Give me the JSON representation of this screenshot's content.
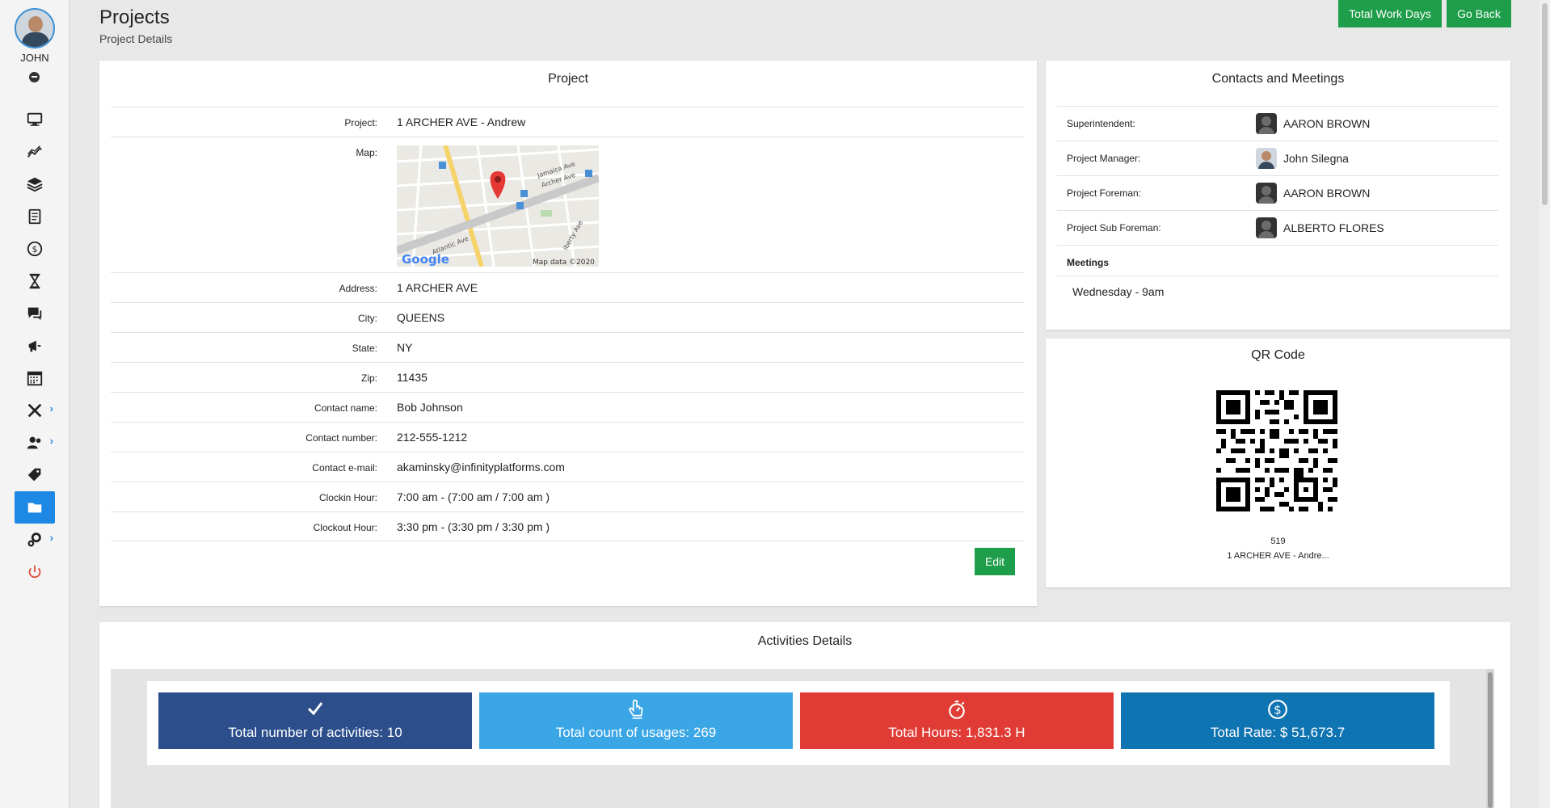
{
  "user": {
    "name": "JOHN"
  },
  "header": {
    "title": "Projects",
    "subtitle": "Project Details"
  },
  "actions": {
    "total_work_days": "Total Work Days",
    "go_back": "Go Back"
  },
  "sidebar": {
    "items": [
      {
        "icon": "monitor-icon",
        "active": false,
        "has_submenu": false
      },
      {
        "icon": "chart-line-icon",
        "active": false,
        "has_submenu": false
      },
      {
        "icon": "layers-icon",
        "active": false,
        "has_submenu": false
      },
      {
        "icon": "document-icon",
        "active": false,
        "has_submenu": false
      },
      {
        "icon": "dollar-icon",
        "active": false,
        "has_submenu": false
      },
      {
        "icon": "hourglass-icon",
        "active": false,
        "has_submenu": false
      },
      {
        "icon": "chat-icon",
        "active": false,
        "has_submenu": false
      },
      {
        "icon": "megaphone-icon",
        "active": false,
        "has_submenu": false
      },
      {
        "icon": "calendar-icon",
        "active": false,
        "has_submenu": false
      },
      {
        "icon": "tools-icon",
        "active": false,
        "has_submenu": true
      },
      {
        "icon": "users-icon",
        "active": false,
        "has_submenu": true
      },
      {
        "icon": "tags-icon",
        "active": false,
        "has_submenu": false
      },
      {
        "icon": "folder-icon",
        "active": true,
        "has_submenu": false
      },
      {
        "icon": "gears-icon",
        "active": false,
        "has_submenu": true
      },
      {
        "icon": "power-icon",
        "active": false,
        "has_submenu": false
      }
    ],
    "chevron": "›"
  },
  "project": {
    "title": "Project",
    "labels": {
      "project": "Project:",
      "map": "Map:",
      "address": "Address:",
      "city": "City:",
      "state": "State:",
      "zip": "Zip:",
      "contact_name": "Contact name:",
      "contact_number": "Contact number:",
      "contact_email": "Contact e-mail:",
      "clockin": "Clockin Hour:",
      "clockout": "Clockout Hour:"
    },
    "values": {
      "project": "1 ARCHER AVE - Andrew",
      "address": "1 ARCHER AVE",
      "city": "QUEENS",
      "state": "NY",
      "zip": "11435",
      "contact_name": "Bob Johnson",
      "contact_number": "212-555-1212",
      "contact_email": "akaminsky@infinityplatforms.com",
      "clockin": "7:00 am - (7:00 am / 7:00 am )",
      "clockout": "3:30 pm - (3:30 pm / 3:30 pm )"
    },
    "map": {
      "street_1": "Jamaica Ave",
      "street_2": "Archer Ave",
      "street_3": "Atlantic Ave",
      "street_4": "iberty Ave",
      "attribution": "Map data ©2020",
      "logo": "Google"
    },
    "edit_label": "Edit"
  },
  "contacts": {
    "title": "Contacts and Meetings",
    "rows": [
      {
        "role": "Superintendent:",
        "name": "AARON BROWN",
        "photo": false
      },
      {
        "role": "Project Manager:",
        "name": "John Silegna",
        "photo": true
      },
      {
        "role": "Project Foreman:",
        "name": "AARON BROWN",
        "photo": false
      },
      {
        "role": "Project Sub Foreman:",
        "name": "ALBERTO FLORES",
        "photo": false
      }
    ],
    "meetings_label": "Meetings",
    "meetings_value": "Wednesday - 9am"
  },
  "qr": {
    "title": "QR Code",
    "number": "519",
    "name": "1 ARCHER AVE - Andre..."
  },
  "activities": {
    "title": "Activities Details",
    "stats": [
      {
        "icon": "check-icon",
        "text": "Total number of activities: 10",
        "color": "#2c4f8c"
      },
      {
        "icon": "hand-pointer-icon",
        "text": "Total count of usages: 269",
        "color": "#3aa6e6"
      },
      {
        "icon": "stopwatch-icon",
        "text": "Total Hours: 1,831.3 H",
        "color": "#e03c35"
      },
      {
        "icon": "dollar-circle-icon",
        "text": "Total Rate: $ 51,673.7",
        "color": "#0f74b2"
      }
    ]
  }
}
